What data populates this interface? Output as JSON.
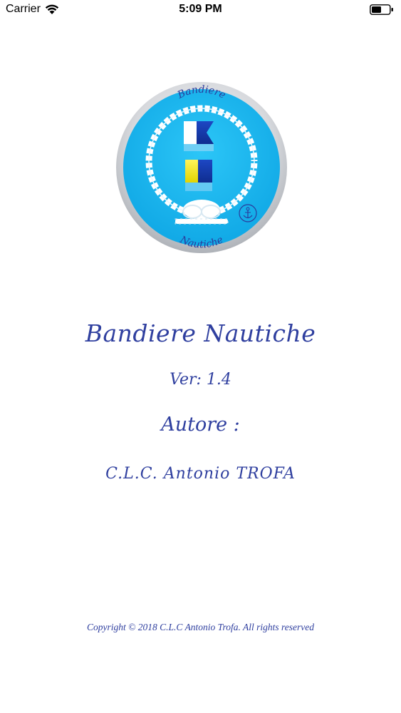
{
  "status_bar": {
    "carrier": "Carrier",
    "time": "5:09 PM",
    "wifi_icon": "wifi-icon",
    "battery_icon": "battery-icon"
  },
  "logo": {
    "top_text": "Bandiere",
    "bottom_text": "Nautiche",
    "colors": {
      "ring_gray": "#c9ccd1",
      "disc_blue": "#19b8f0",
      "rope_white": "#ffffff",
      "flag_blue": "#1a3fae",
      "flag_yellow": "#f2ea1c",
      "text_blue": "#2a3b9c"
    }
  },
  "content": {
    "app_title": "Bandiere Nautiche",
    "version": "Ver: 1.4",
    "author_label": "Autore :",
    "author_name": "C.L.C. Antonio TROFA",
    "copyright": "Copyright © 2018 C.L.C Antonio Trofa. All rights reserved"
  },
  "theme": {
    "text_color": "#2f3f9f",
    "background": "#ffffff"
  }
}
